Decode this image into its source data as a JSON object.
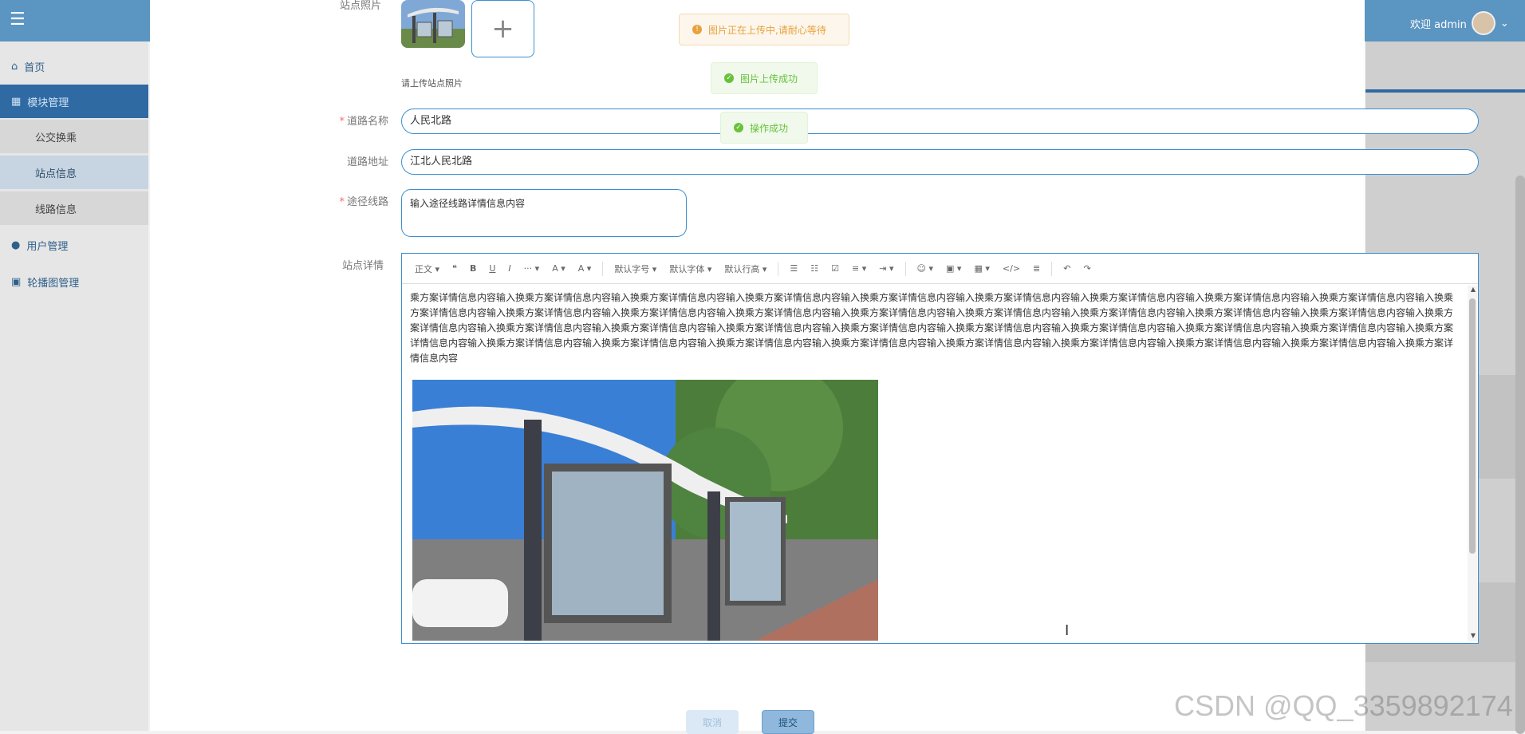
{
  "app": {
    "welcome": "欢迎 admin",
    "sidebar": [
      {
        "label": "首页"
      },
      {
        "label": "模块管理"
      },
      {
        "label": "公交换乘"
      },
      {
        "label": "站点信息"
      },
      {
        "label": "线路信息"
      },
      {
        "label": "用户管理"
      },
      {
        "label": "轮播图管理"
      }
    ]
  },
  "form": {
    "photo_label": "站点照片",
    "photo_hint": "请上传站点照片",
    "road_name_label": "道路名称",
    "road_name_value": "人民北路",
    "road_address_label": "道路地址",
    "road_address_value": "江北人民北路",
    "route_label": "途径线路",
    "route_value": "输入途径线路详情信息内容",
    "detail_label": "站点详情"
  },
  "editor": {
    "toolbar": [
      "正文",
      "❝",
      "B",
      "U",
      "I",
      "···",
      "A",
      "A",
      "默认字号",
      "默认字体",
      "默认行高",
      "☰",
      "☷",
      "☑",
      "≡",
      "⇥",
      "☺",
      "▣",
      "▦",
      "</>",
      "≣",
      "↶",
      "↷"
    ],
    "content": "乘方案详情信息内容输入换乘方案详情信息内容输入换乘方案详情信息内容输入换乘方案详情信息内容输入换乘方案详情信息内容输入换乘方案详情信息内容输入换乘方案详情信息内容输入换乘方案详情信息内容输入换乘方案详情信息内容输入换乘方案详情信息内容输入换乘方案详情信息内容输入换乘方案详情信息内容输入换乘方案详情信息内容输入换乘方案详情信息内容输入换乘方案详情信息内容输入换乘方案详情信息内容输入换乘方案详情信息内容输入换乘方案详情信息内容输入换乘方案详情信息内容输入换乘方案详情信息内容输入换乘方案详情信息内容输入换乘方案详情信息内容输入换乘方案详情信息内容输入换乘方案详情信息内容输入换乘方案详情信息内容输入换乘方案详情信息内容输入换乘方案详情信息内容输入换乘方案详情信息内容输入换乘方案详情信息内容输入换乘方案详情信息内容输入换乘方案详情信息内容输入换乘方案详情信息内容输入换乘方案详情信息内容输入换乘方案详情信息内容输入换乘方案详情信息内容输入换乘方案详情信息内容输入换乘方案详情信息内容"
  },
  "buttons": {
    "cancel": "取消",
    "submit": "提交"
  },
  "toasts": {
    "uploading": "图片正在上传中,请耐心等待",
    "upload_success": "图片上传成功",
    "op_success": "操作成功"
  },
  "watermark": "CSDN @QQ_3359892174",
  "colors": {
    "accent": "#3b8fd0",
    "sidebar_active": "#2f6aa3",
    "warning": "#e6a23c",
    "success": "#67c23a",
    "required": "#f56c6c"
  }
}
